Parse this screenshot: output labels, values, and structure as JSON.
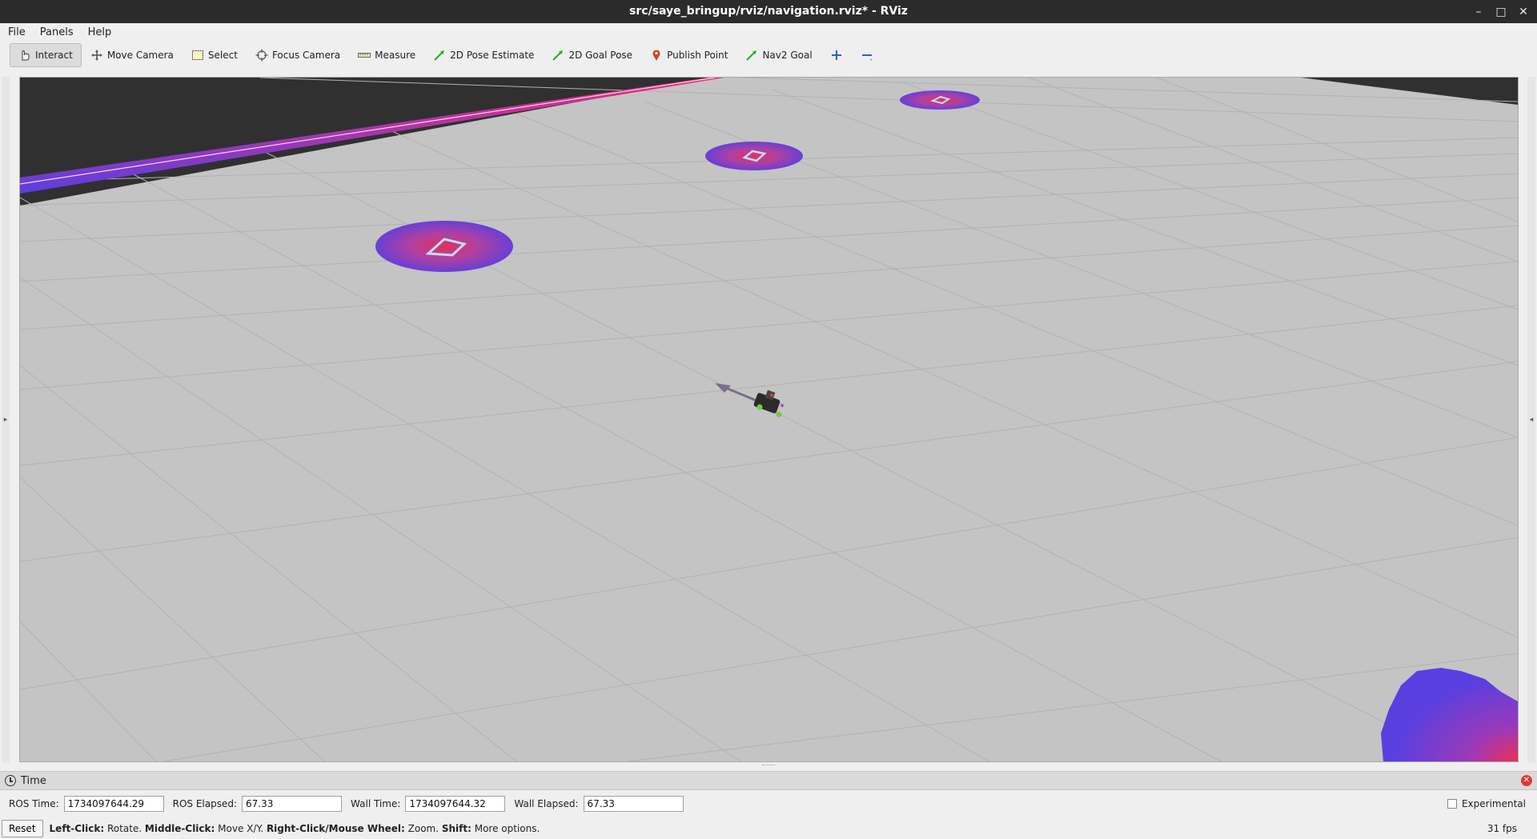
{
  "window": {
    "title": "src/saye_bringup/rviz/navigation.rviz* - RViz"
  },
  "menu": {
    "items": [
      {
        "label": "File"
      },
      {
        "label": "Panels"
      },
      {
        "label": "Help"
      }
    ]
  },
  "toolbar": {
    "tools": [
      {
        "label": "Interact",
        "icon": "hand-pointer-icon",
        "active": true
      },
      {
        "label": "Move Camera",
        "icon": "move-camera-icon"
      },
      {
        "label": "Select",
        "icon": "select-box-icon"
      },
      {
        "label": "Focus Camera",
        "icon": "focus-target-icon"
      },
      {
        "label": "Measure",
        "icon": "ruler-icon"
      },
      {
        "label": "2D Pose Estimate",
        "icon": "green-arrow-icon"
      },
      {
        "label": "2D Goal Pose",
        "icon": "green-arrow-icon"
      },
      {
        "label": "Publish Point",
        "icon": "map-pin-icon"
      },
      {
        "label": "Nav2 Goal",
        "icon": "green-arrow-icon"
      }
    ],
    "add_icon": "plus-icon",
    "remove_icon": "minus-icon"
  },
  "viewport": {
    "background_color": "#c4c4c4",
    "costmap_colors": [
      "#5a3fe0",
      "#c0407a",
      "#e5305a"
    ]
  },
  "time_panel": {
    "title": "Time",
    "ros_time_label": "ROS Time:",
    "ros_time": "1734097644.29",
    "ros_elapsed_label": "ROS Elapsed:",
    "ros_elapsed": "67.33",
    "wall_time_label": "Wall Time:",
    "wall_time": "1734097644.32",
    "wall_elapsed_label": "Wall Elapsed:",
    "wall_elapsed": "67.33",
    "experimental_label": "Experimental",
    "experimental_checked": false
  },
  "status": {
    "reset_label": "Reset",
    "hint_left_key": "Left-Click:",
    "hint_left": " Rotate. ",
    "hint_middle_key": "Middle-Click:",
    "hint_middle": " Move X/Y. ",
    "hint_right_key": "Right-Click/Mouse Wheel:",
    "hint_right": " Zoom. ",
    "hint_shift_key": "Shift:",
    "hint_shift": " More options.",
    "fps": "31 fps"
  }
}
